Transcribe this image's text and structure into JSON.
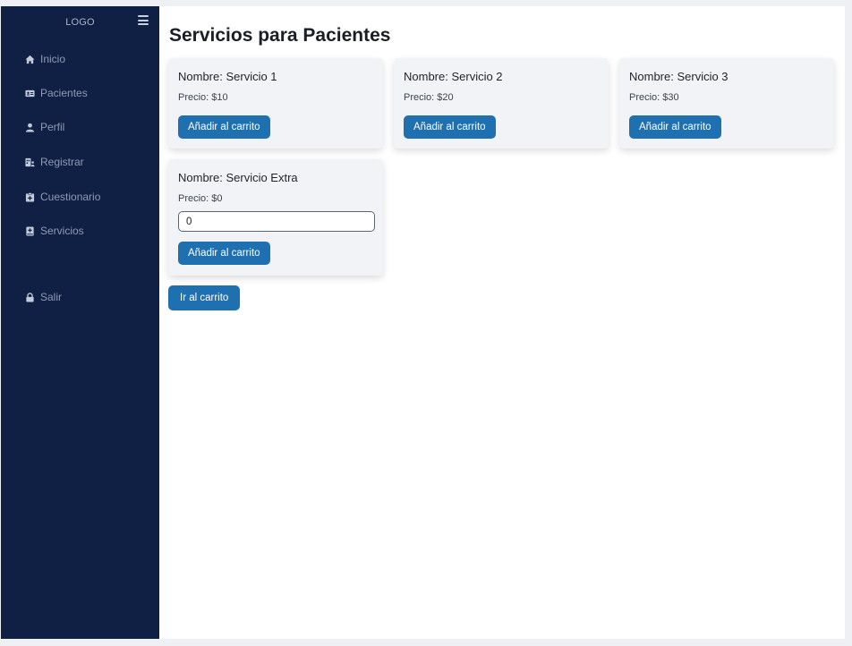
{
  "sidebar": {
    "logo": "LOGO",
    "menu_icon": "hamburger-menu-icon",
    "items": [
      {
        "label": "Inicio",
        "icon": "home-icon"
      },
      {
        "label": "Pacientes",
        "icon": "id-card-icon"
      },
      {
        "label": "Perfil",
        "icon": "user-icon"
      },
      {
        "label": "Registrar",
        "icon": "register-user-icon"
      },
      {
        "label": "Cuestionario",
        "icon": "clipboard-icon"
      },
      {
        "label": "Servicios",
        "icon": "book-icon"
      }
    ],
    "logout": {
      "label": "Salir",
      "icon": "lock-icon"
    }
  },
  "main": {
    "title": "Servicios para Pacientes",
    "services": [
      {
        "name": "Nombre: Servicio 1",
        "price": "Precio: $10",
        "button": "Añadir al carrito"
      },
      {
        "name": "Nombre: Servicio 2",
        "price": "Precio: $20",
        "button": "Añadir al carrito"
      },
      {
        "name": "Nombre: Servicio 3",
        "price": "Precio: $30",
        "button": "Añadir al carrito"
      }
    ],
    "extra": {
      "name": "Nombre: Servicio Extra",
      "price": "Precio: $0",
      "quantity": "0",
      "button": "Añadir al carrito"
    },
    "cart_button": "Ir al carrito"
  },
  "colors": {
    "sidebar_bg": "#0f2044",
    "sidebar_text": "#8f9bb6",
    "button_bg": "#1f70b1",
    "card_bg": "#f2f3f6"
  }
}
